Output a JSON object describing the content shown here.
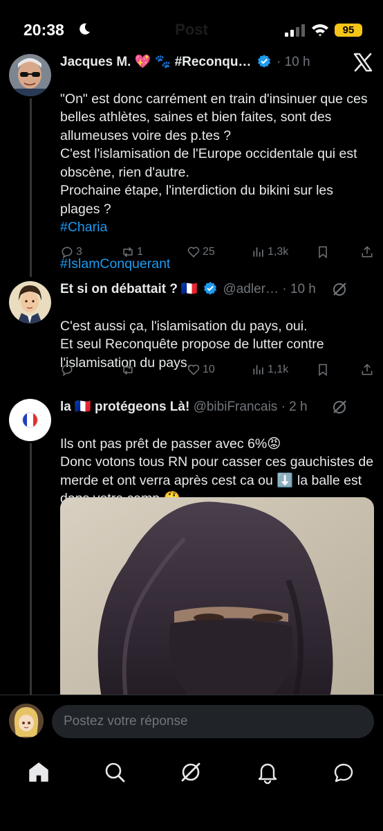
{
  "status_bar": {
    "time": "20:38",
    "battery": "95",
    "ghost_title": "Post"
  },
  "tweets": [
    {
      "display_name": "Jacques M. 💖 🐾 #Reconqu…",
      "timestamp": "· 10 h",
      "body": "\"On\" est donc carrément en train d'insinuer que ces belles athlètes, saines et bien faites, sont des allumeuses voire des p.tes ?\nC'est l'islamisation de l'Europe occidentale qui est obscène, rien d'autre.\nProchaine étape, l'interdiction du bikini sur les plages ?",
      "hashtags": [
        "#Charia",
        "#IslamConquerant"
      ],
      "replies": "3",
      "reposts": "1",
      "likes": "25",
      "views": "1,3k"
    },
    {
      "display_name": "Et si on débattait ? 🇫🇷",
      "handle": "@adler…",
      "timestamp": "· 10 h",
      "body": "C'est aussi ça, l'islamisation du pays, oui.\nEt seul Reconquête propose de lutter contre l'islamisation du pays.",
      "replies": "",
      "reposts": "",
      "likes": "10",
      "views": "1,1k"
    },
    {
      "display_name": "la 🇫🇷 protégeons Là!",
      "handle": "@bibiFrancais",
      "timestamp": "· 2 h",
      "body": "Ils ont pas prêt de passer avec 6%😡\nDonc votons tous RN pour casser ces gauchistes de merde et ont verra après cest ca ou ⬇️ la balle est dans votre camp 🤔"
    }
  ],
  "reply_bar": {
    "placeholder": "Postez votre réponse"
  },
  "colors": {
    "background": "#000000",
    "text": "#e7e9ea",
    "muted": "#71767b",
    "link": "#1d9bf0",
    "verified": "#1d9bf0",
    "battery": "#f5c518"
  },
  "icons": [
    "moon-icon",
    "signal-icon",
    "wifi-icon",
    "x-logo-icon",
    "verified-icon",
    "grok-icon",
    "reply-icon",
    "repost-icon",
    "like-icon",
    "views-icon",
    "bookmark-icon",
    "share-icon",
    "home-icon",
    "search-icon",
    "grok-tab-icon",
    "notifications-icon",
    "messages-icon"
  ]
}
